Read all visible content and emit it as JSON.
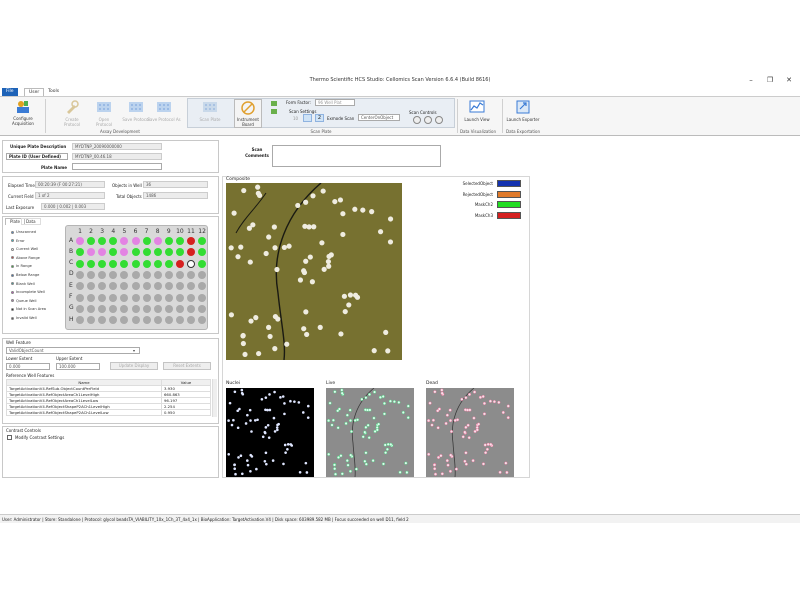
{
  "window": {
    "title": "Thermo Scientific HCS Studio: Cellomics Scan Version 6.6.4 (Build 8616)"
  },
  "ribbon": {
    "tabs": [
      "File",
      "User",
      "Tools"
    ],
    "configure_acquisition": "Configure Acquisition",
    "assay_dev_buttons": [
      "Create Protocol",
      "Open Protocol",
      "Save Protocol",
      "Save Protocol As"
    ],
    "assay_development_label": "Assay Development",
    "scan_plate_button": "Scan Plate",
    "instrument_board": "Instrument Board",
    "form_factor_label": "Form Factor:",
    "form_factor_value": "96 Well Plat",
    "scan_settings_label": "Scan Settings",
    "scan_setting_number": "10",
    "exmode_scan_label": "Exmode Scan",
    "exmode_scan_value": "CenterOnObject",
    "scan_controls_label": "Scan Controls",
    "scan_plate_label": "Scan Plate",
    "launch_view": "Launch View",
    "data_visualization_label": "Data Visualization",
    "launch_exporter": "Launch Exporter",
    "data_exportation_label": "Data Exportation"
  },
  "plate_info": {
    "unique_desc_label": "Unique Plate Description",
    "unique_desc_value": "MYDTNP_20090000000",
    "plate_id_label": "Plate ID (User Defined)",
    "plate_id_value": "MYDTNP_00.46.18",
    "plate_name_label": "Plate Name",
    "scan_comments_label": "Scan Comments"
  },
  "stats": {
    "elapsed_time_label": "Elapsed Time",
    "elapsed_time_value": "00:20:39 (F 00:27:21)",
    "objects_in_well_label": "Objects in Well",
    "objects_in_well_value": "36",
    "current_field_label": "Current Field",
    "current_field_value": "1 of 2",
    "total_objects_label": "Total Objects",
    "total_objects_value": "1486",
    "last_exposure_label": "Last Exposure",
    "last_exposure_value": "0.000 | 0.002 | 0.003"
  },
  "plate_view": {
    "tabs": [
      "Plate",
      "Data"
    ],
    "legend": [
      "Unscanned",
      "Error",
      "Current Well",
      "Above Range",
      "In Range",
      "Below Range",
      "Blank Well",
      "Incomplete Well",
      "Queue Well",
      "Not in Scan Area",
      "Invalid Well"
    ],
    "legend_colors": [
      "#4a8cd6",
      "#2fc6d0",
      "#ffffff",
      "#d43a3a",
      "#2cc22c",
      "#2f6fc0",
      "#3aa0a0",
      "#c844c8",
      "#b080b0",
      "#222222",
      "#555555"
    ],
    "columns": [
      "1",
      "2",
      "3",
      "4",
      "5",
      "6",
      "7",
      "8",
      "9",
      "10",
      "11",
      "12"
    ],
    "rows": [
      "A",
      "B",
      "C",
      "D",
      "E",
      "F",
      "G",
      "H"
    ],
    "well_states": [
      [
        "P",
        "G",
        "G",
        "G",
        "P",
        "P",
        "G",
        "P",
        "G",
        "G",
        "R",
        "G"
      ],
      [
        "G",
        "P",
        "P",
        "G",
        "P",
        "G",
        "G",
        "G",
        "G",
        "G",
        "R",
        "G"
      ],
      [
        "G",
        "G",
        "G",
        "G",
        "G",
        "G",
        "G",
        "G",
        "G",
        "R",
        "W",
        "G"
      ],
      [
        "U",
        "U",
        "U",
        "U",
        "U",
        "U",
        "U",
        "U",
        "U",
        "U",
        "U",
        "U"
      ],
      [
        "U",
        "U",
        "U",
        "U",
        "U",
        "U",
        "U",
        "U",
        "U",
        "U",
        "U",
        "U"
      ],
      [
        "U",
        "U",
        "U",
        "U",
        "U",
        "U",
        "U",
        "U",
        "U",
        "U",
        "U",
        "U"
      ],
      [
        "U",
        "U",
        "U",
        "U",
        "U",
        "U",
        "U",
        "U",
        "U",
        "U",
        "U",
        "U"
      ],
      [
        "U",
        "U",
        "U",
        "U",
        "U",
        "U",
        "U",
        "U",
        "U",
        "U",
        "U",
        "U"
      ]
    ],
    "well_colors": {
      "G": "#33dd33",
      "P": "#e383e3",
      "R": "#d62020",
      "W": "#ffffff",
      "U": "#a9a9a9"
    }
  },
  "well_feature": {
    "title": "Well Feature",
    "selected": "ValidObjectCount",
    "lower_extent_label": "Lower Extent",
    "lower_extent_value": "0.000",
    "upper_extent_label": "Upper Extent",
    "upper_extent_value": "100.000",
    "update_display": "Update Display",
    "reset_extents": "Reset Extents",
    "ref_features_label": "Reference Well Features",
    "col_name": "Name",
    "col_value": "Value",
    "rows": [
      {
        "name": "TargetActivationV4.RefSub.ObjectCountPerField",
        "value": "3.930"
      },
      {
        "name": "TargetActivationV4.RefObjectAreaCh1LevelHigh",
        "value": "660.863"
      },
      {
        "name": "TargetActivationV4.RefObjectAreaCh1LevelLow",
        "value": "96.197"
      },
      {
        "name": "TargetActivationV4.RefObjectShapeP2ACh1LevelHigh",
        "value": "2.254"
      },
      {
        "name": "TargetActivationV4.RefObjectShapeP2ACh1LevelLow",
        "value": "0.950"
      }
    ]
  },
  "contrast": {
    "title": "Contrast Controls",
    "modify_label": "Modify Contrast Settings"
  },
  "images": {
    "composite_label": "Composite",
    "nuclei_label": "Nuclei",
    "live_label": "Live",
    "dead_label": "Dead",
    "legend": [
      {
        "name": "SelectedObject",
        "color": "#1433b0"
      },
      {
        "name": "RejectedObject",
        "color": "#e07a2a"
      },
      {
        "name": "MaskCh2",
        "color": "#22dd22"
      },
      {
        "name": "MaskCh3",
        "color": "#d42020"
      }
    ]
  },
  "status_bar": {
    "text": "User: Administrator  |  Store: Standalone  |  Protocol: glycol beadsTA_VIABILITY_10x_1Ch_3T_4x4_1x  |  BioApplication: TargetActivation.V4  |  Disk space: 603989.582 MB  |  Focus succeeded on well D11, field 2"
  }
}
